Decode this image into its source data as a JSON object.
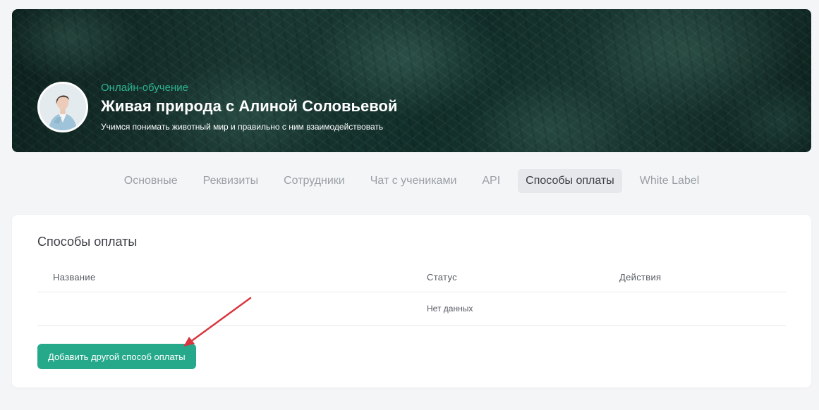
{
  "banner": {
    "category": "Онлайн-обучение",
    "title": "Живая природа с Алиной Соловьевой",
    "subtitle": "Учимся понимать животный мир и правильно с ним взаимодействовать"
  },
  "tabs": [
    {
      "label": "Основные",
      "active": false
    },
    {
      "label": "Реквизиты",
      "active": false
    },
    {
      "label": "Сотрудники",
      "active": false
    },
    {
      "label": "Чат с учениками",
      "active": false
    },
    {
      "label": "API",
      "active": false
    },
    {
      "label": "Способы оплаты",
      "active": true
    },
    {
      "label": "White Label",
      "active": false
    }
  ],
  "payment_methods": {
    "title": "Способы оплаты",
    "columns": {
      "name": "Название",
      "status": "Статус",
      "actions": "Действия"
    },
    "empty_text": "Нет данных",
    "add_button": "Добавить другой способ оплаты"
  },
  "colors": {
    "accent": "#26a98b",
    "category_text": "#2fb293",
    "annotation_arrow": "#d9363e"
  }
}
